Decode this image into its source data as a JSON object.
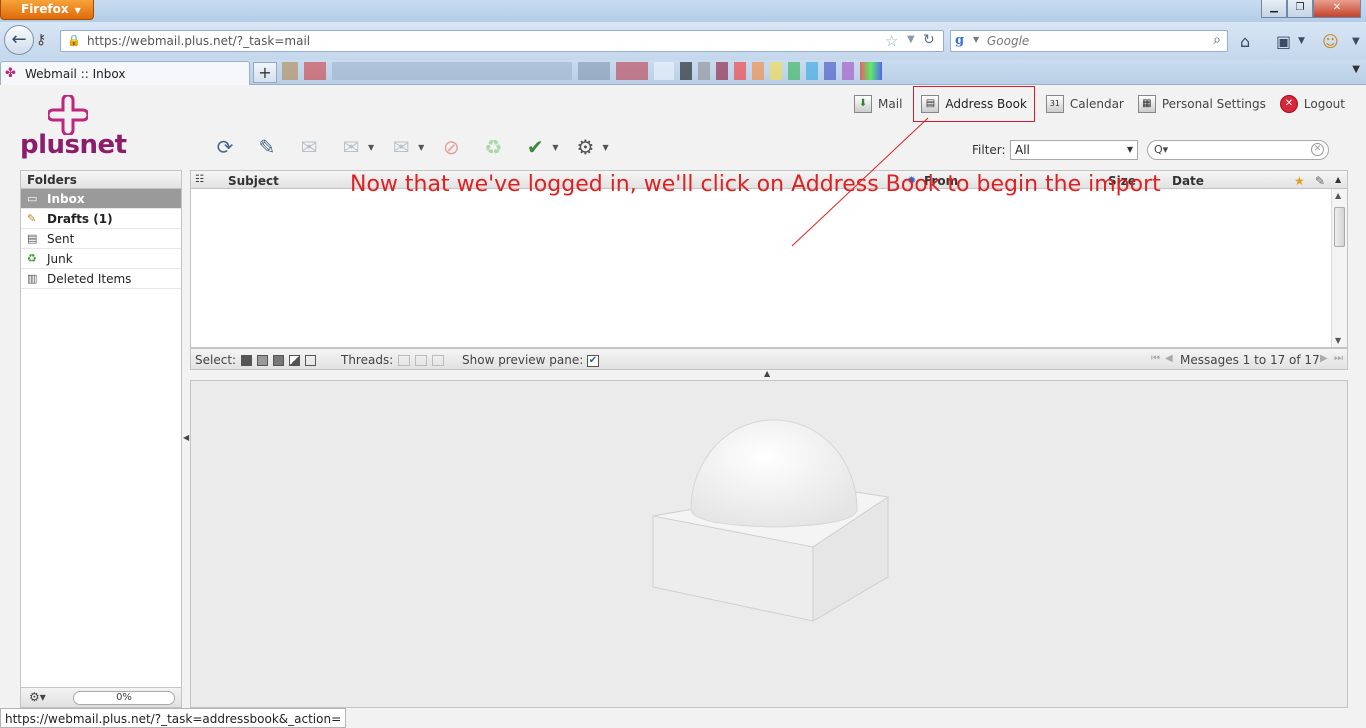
{
  "browser": {
    "app_button": "Firefox",
    "url": "https://webmail.plus.net/?_task=mail",
    "search_placeholder": "Google",
    "tab_title": "Webmail :: Inbox",
    "new_tab": "+",
    "status_url": "https://webmail.plus.net/?_task=addressbook&_action="
  },
  "brand": {
    "logo_text": "plusnet",
    "color": "#8c1c6c"
  },
  "topnav": {
    "mail": "Mail",
    "address_book": "Address Book",
    "calendar": "Calendar",
    "calendar_icon_text": "31",
    "settings": "Personal Settings",
    "logout": "Logout"
  },
  "toolbar": {
    "icons": [
      "refresh-icon",
      "compose-icon",
      "reply-icon",
      "reply-all-icon",
      "forward-icon",
      "delete-icon",
      "archive-icon",
      "mark-icon",
      "more-icon"
    ]
  },
  "filter": {
    "label": "Filter:",
    "value": "All"
  },
  "folders": {
    "header": "Folders",
    "items": [
      {
        "label": "Inbox",
        "icon": "inbox-icon"
      },
      {
        "label": "Drafts (1)",
        "icon": "drafts-icon"
      },
      {
        "label": "Sent",
        "icon": "sent-icon"
      },
      {
        "label": "Junk",
        "icon": "junk-icon"
      },
      {
        "label": "Deleted Items",
        "icon": "trash-icon"
      }
    ],
    "quota": "0%"
  },
  "message_list": {
    "columns": {
      "subject": "Subject",
      "from": "From",
      "size": "Size",
      "date": "Date"
    }
  },
  "list_footer": {
    "select_label": "Select:",
    "threads_label": "Threads:",
    "preview_label": "Show preview pane:",
    "messages_count": "Messages 1 to 17 of 17"
  },
  "annotation": "Now that we've logged in, we'll click on Address Book to begin the import",
  "colors": {
    "annotation": "#e02020",
    "highlight_border": "#d21c2e"
  }
}
